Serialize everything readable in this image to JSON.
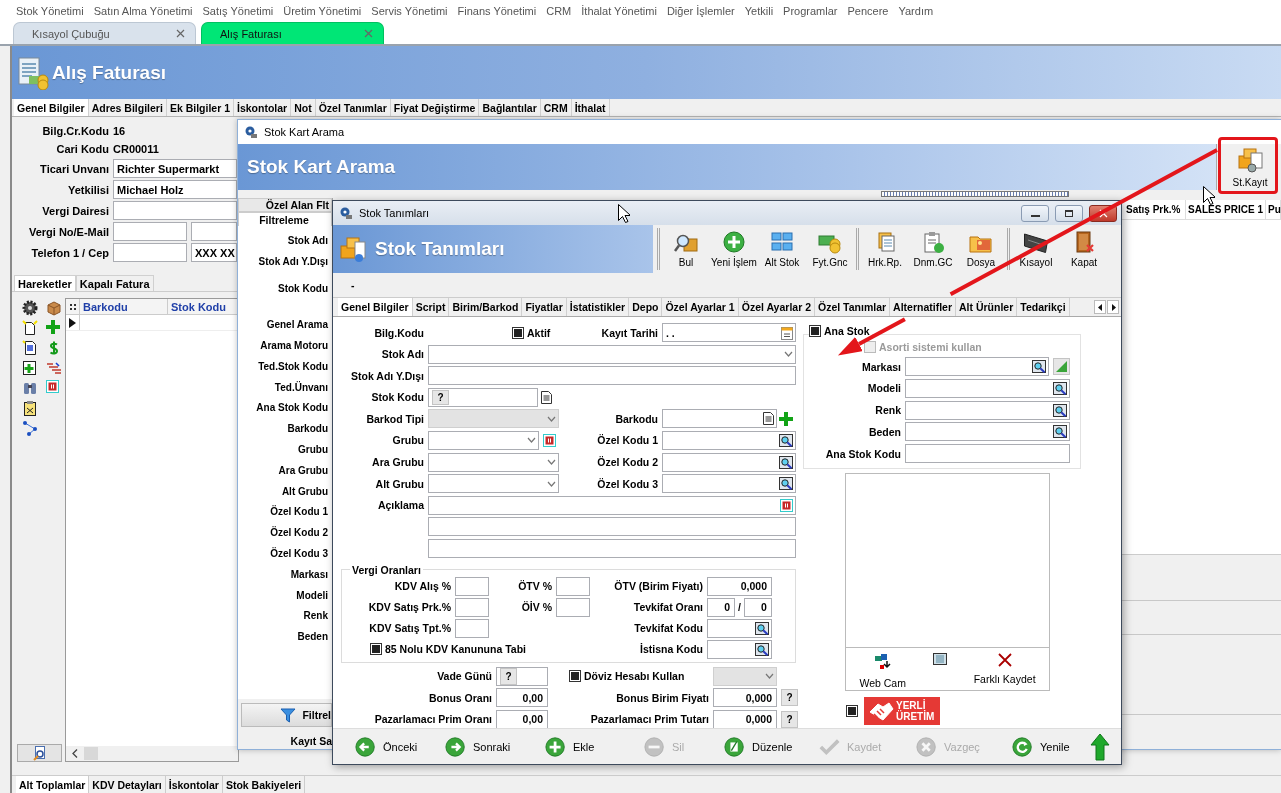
{
  "menu_bar": [
    "Stok Yönetimi",
    "Satın Alma Yönetimi",
    "Satış Yönetimi",
    "Üretim Yönetimi",
    "Servis Yönetimi",
    "Finans Yönetimi",
    "CRM",
    "İthalat Yönetimi",
    "Diğer İşlemler",
    "Yetkili",
    "Programlar",
    "Pencere",
    "Yardım"
  ],
  "document_tabs": [
    {
      "label": "Kısayol Çubuğu",
      "selected": false
    },
    {
      "label": "Alış Faturası",
      "selected": true
    }
  ],
  "purchase_invoice": {
    "title": "Alış Faturası",
    "tabs": [
      {
        "label": "Genel Bilgiler",
        "selected": true
      },
      {
        "label": "Adres Bilgileri",
        "selected": false
      },
      {
        "label": "Ek Bilgiler 1",
        "selected": false
      },
      {
        "label": "İskontolar",
        "selected": false
      },
      {
        "label": "Not",
        "selected": false
      },
      {
        "label": "Özel Tanımlar",
        "selected": false
      },
      {
        "label": "Fiyat Değiştirme",
        "selected": false
      },
      {
        "label": "Bağlantılar",
        "selected": false
      },
      {
        "label": "CRM",
        "selected": false
      },
      {
        "label": "İthalat",
        "selected": false
      }
    ],
    "fields": [
      {
        "label": "Bilg.Cr.Kodu",
        "kind": "text",
        "value": "16"
      },
      {
        "label": "Cari Kodu",
        "kind": "text",
        "value": "CR00011"
      },
      {
        "label": "Ticari Unvanı",
        "kind": "input",
        "value": "Richter Supermarkt"
      },
      {
        "label": "Yetkilisi",
        "kind": "input",
        "value": "Michael Holz"
      },
      {
        "label": "Vergi Dairesi",
        "kind": "input"
      },
      {
        "label": "Vergi No/E-Mail",
        "kind": "pair"
      },
      {
        "label": "Telefon 1 / Cep",
        "kind": "pair",
        "value2": "XXX XX"
      }
    ],
    "line_tabs": [
      {
        "label": "Hareketler",
        "selected": true
      },
      {
        "label": "Kapalı Fatura",
        "selected": false
      }
    ],
    "lines_table": {
      "columns": [
        "Barkodu",
        "Stok Kodu"
      ]
    },
    "bottom_tabs": [
      {
        "label": "Alt Toplamlar",
        "selected": true
      },
      {
        "label": "KDV Detayları",
        "selected": false
      },
      {
        "label": "İskontolar",
        "selected": false
      },
      {
        "label": "Stok Bakiyeleri",
        "selected": false
      }
    ]
  },
  "stock_search": {
    "title": "Stok Kart Arama",
    "header": "Stok Kart Arama",
    "toolbar": [
      {
        "label": "St.Kayıt",
        "highlighted": true
      }
    ],
    "filter_tabs": [
      {
        "label": "Özel Alan Flt",
        "selected": false
      },
      {
        "label": "Filtreleme",
        "selected": true
      }
    ],
    "filter_labels": [
      "Stok Adı",
      "Stok Adı Y.Dışı",
      "Stok Kodu",
      "Genel Arama",
      "Arama Motoru",
      "Ted.Stok Kodu",
      "Ted.Ünvanı",
      "Ana Stok Kodu",
      "Barkodu",
      "Grubu",
      "Ara Grubu",
      "Alt Grubu",
      "Özel Kodu 1",
      "Özel Kodu 2",
      "Özel Kodu 3",
      "Markası",
      "Modeli",
      "Renk",
      "Beden"
    ],
    "filter_button": "Filtrel",
    "record_label": "Kayıt Sa",
    "results_columns": [
      "Satış Prk.%",
      "SALES PRICE 1",
      "Pu"
    ]
  },
  "stock_definition": {
    "title": "Stok Tanımları",
    "header": "Stok Tanımları",
    "toolbar": [
      {
        "label": "Bul",
        "kind": "find"
      },
      {
        "label": "Yeni İşlem",
        "kind": "new"
      },
      {
        "label": "Alt Stok",
        "kind": "substock"
      },
      {
        "label": "Fyt.Gnc",
        "kind": "price"
      },
      {
        "label": "Hrk.Rp.",
        "kind": "movement"
      },
      {
        "label": "Dnm.GC",
        "kind": "period"
      },
      {
        "label": "Dosya",
        "kind": "file"
      },
      {
        "label": "Kısayol",
        "kind": "shortcut"
      },
      {
        "label": "Kapat",
        "kind": "close"
      }
    ],
    "strip_text": "-",
    "tabs": [
      {
        "label": "Genel Bilgiler",
        "selected": true
      },
      {
        "label": "Script",
        "selected": false
      },
      {
        "label": "Birim/Barkod",
        "selected": false
      },
      {
        "label": "Fiyatlar",
        "selected": false
      },
      {
        "label": "İstatistikler",
        "selected": false
      },
      {
        "label": "Depo",
        "selected": false
      },
      {
        "label": "Özel Ayarlar 1",
        "selected": false
      },
      {
        "label": "Özel Ayarlar 2",
        "selected": false
      },
      {
        "label": "Özel Tanımlar",
        "selected": false
      },
      {
        "label": "Alternatifler",
        "selected": false
      },
      {
        "label": "Alt Ürünler",
        "selected": false
      },
      {
        "label": "Tedarikçi",
        "selected": false
      }
    ],
    "rows": [
      {
        "label": "Bilg.Kodu",
        "kind": "static",
        "check": {
          "label": "Aktif",
          "checked": true
        },
        "side": {
          "label": "Kayıt Tarihi",
          "kind": "date",
          "value": ". ."
        }
      },
      {
        "label": "Stok Adı",
        "kind": "combo",
        "disabled": false
      },
      {
        "label": "Stok Adı Y.Dışı",
        "kind": "input"
      },
      {
        "label": "Stok Kodu",
        "kind": "code",
        "button": "?"
      },
      {
        "label": "Barkod Tipi",
        "kind": "combo",
        "disabled": true,
        "side": {
          "label": "Barkodu",
          "kind": "barcode"
        }
      },
      {
        "label": "Grubu",
        "kind": "group",
        "disabled": false,
        "side": {
          "label": "Özel Kodu 1",
          "kind": "lookup"
        }
      },
      {
        "label": "Ara Grubu",
        "kind": "combo",
        "disabled": false,
        "side": {
          "label": "Özel Kodu 2",
          "kind": "lookup"
        }
      },
      {
        "label": "Alt Grubu",
        "kind": "combo",
        "disabled": false,
        "side": {
          "label": "Özel Kodu 3",
          "kind": "lookup"
        }
      },
      {
        "label": "Açıklama",
        "kind": "note"
      },
      {
        "kind": "input"
      },
      {
        "kind": "input"
      }
    ],
    "tax": {
      "title": "Vergi Oranları",
      "rows": [
        {
          "left": {
            "label": "KDV Alış %",
            "kind": "box"
          },
          "middle": {
            "label": "ÖTV %",
            "kind": "box"
          },
          "right": {
            "label": "ÖTV (Birim Fiyatı)",
            "kind": "amount",
            "value": "0,000"
          }
        },
        {
          "left": {
            "label": "KDV Satış Prk.%",
            "kind": "box"
          },
          "middle": {
            "label": "ÖİV %",
            "kind": "box"
          },
          "right": {
            "label": "Tevkifat Oranı",
            "kind": "ratio",
            "values": [
              "0",
              "0"
            ],
            "separator": "/"
          }
        },
        {
          "left": {
            "label": "KDV Satış Tpt.%",
            "kind": "box"
          },
          "right": {
            "label": "Tevkifat Kodu",
            "kind": "lookup"
          }
        },
        {
          "left": {
            "label": "85 Nolu KDV Kanununa Tabi",
            "kind": "check",
            "checked": true
          },
          "right": {
            "label": "İstisna Kodu",
            "kind": "lookup"
          }
        }
      ]
    },
    "terms": [
      {
        "left": {
          "label": "Vade Günü",
          "kind": "help",
          "button": "?"
        },
        "right": {
          "label": "Döviz Hesabı Kullan",
          "kind": "check_combo",
          "checked": true,
          "combo_disabled": true
        }
      },
      {
        "left": {
          "label": "Bonus Oranı",
          "kind": "amount",
          "value": "0,00"
        },
        "right": {
          "label": "Bonus Birim Fiyatı",
          "kind": "amount_help",
          "value": "0,000",
          "button": "?"
        }
      },
      {
        "left": {
          "label": "Pazarlamacı Prim Oranı",
          "kind": "amount",
          "value": "0,00"
        },
        "right": {
          "label": "Pazarlamacı Prim Tutarı",
          "kind": "amount_help",
          "value": "0,000",
          "button": "?"
        }
      }
    ],
    "main_stock": {
      "label": "Ana Stok",
      "checked": true
    },
    "assortment": {
      "label": "Asorti sistemi kullan",
      "checked": false,
      "disabled": true
    },
    "variant_fields": [
      {
        "label": "Markası",
        "kind": "brand"
      },
      {
        "label": "Modeli",
        "kind": "lookup"
      },
      {
        "label": "Renk",
        "kind": "lookup"
      },
      {
        "label": "Beden",
        "kind": "lookup"
      },
      {
        "label": "Ana Stok Kodu",
        "kind": "input"
      }
    ],
    "image_actions": [
      {
        "kind": "webcam",
        "label": "Web Cam"
      },
      {
        "kind": "screen"
      },
      {
        "kind": "clear",
        "label": "Farklı Kaydet"
      }
    ],
    "local_production": {
      "checked": true,
      "badge": "YERLİ ÜRETİM"
    },
    "actions": [
      {
        "label": "Önceki",
        "kind": "previous",
        "disabled": false
      },
      {
        "label": "Sonraki",
        "kind": "next",
        "disabled": false
      },
      {
        "label": "Ekle",
        "kind": "add",
        "disabled": false
      },
      {
        "label": "Sil",
        "kind": "delete",
        "disabled": true
      },
      {
        "label": "Düzenle",
        "kind": "edit",
        "disabled": false
      },
      {
        "label": "Kaydet",
        "kind": "save",
        "disabled": true
      },
      {
        "label": "Vazgeç",
        "kind": "cancel",
        "disabled": true
      },
      {
        "label": "Yenile",
        "kind": "refresh",
        "disabled": false
      }
    ]
  }
}
